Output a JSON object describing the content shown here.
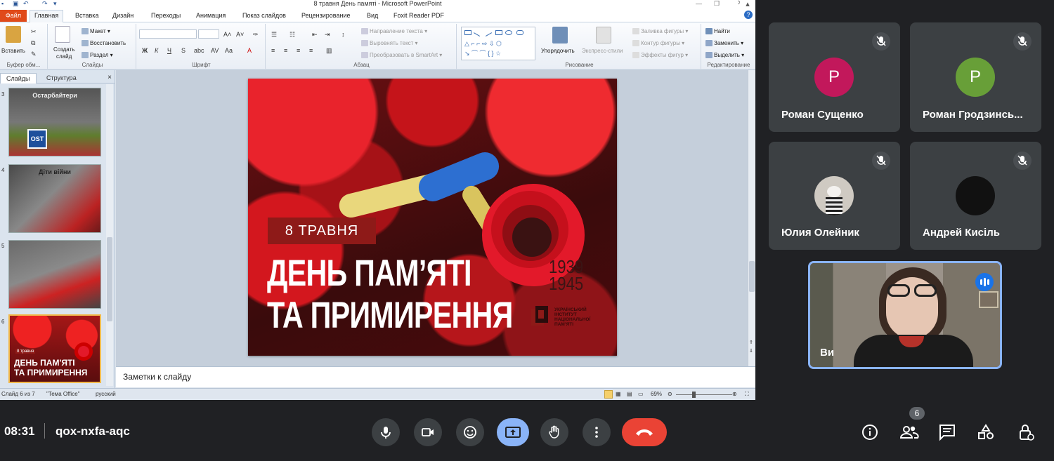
{
  "ppt": {
    "window_title": "8 травня День памяті - Microsoft PowerPoint",
    "tabs": [
      "Файл",
      "Главная",
      "Вставка",
      "Дизайн",
      "Переходы",
      "Анимация",
      "Показ слайдов",
      "Рецензирование",
      "Вид",
      "Foxit Reader PDF"
    ],
    "ribbon": {
      "clipboard": {
        "paste": "Вставить",
        "label": "Буфер обм..."
      },
      "slides": {
        "new_slide_l1": "Создать",
        "new_slide_l2": "слайд",
        "layout": "Макет",
        "reset": "Восстановить",
        "section": "Раздел",
        "label": "Слайды"
      },
      "font": {
        "label": "Шрифт",
        "bold": "Ж",
        "italic": "К",
        "underline": "Ч",
        "strike": "S",
        "shadow": "abc",
        "spacing": "AV",
        "case": "Aa",
        "color": "A"
      },
      "paragraph": {
        "text_direction": "Направление текста",
        "align_text": "Выровнять текст",
        "smartart": "Преобразовать в SmartArt",
        "label": "Абзац"
      },
      "drawing": {
        "arrange": "Упорядочить",
        "quick_styles": "Экспресс-стили",
        "shape_fill": "Заливка фигуры",
        "shape_outline": "Контур фигуры",
        "shape_effects": "Эффекты фигур",
        "label": "Рисование"
      },
      "editing": {
        "find": "Найти",
        "replace": "Заменить",
        "select": "Выделить",
        "label": "Редактирование"
      }
    },
    "pane": {
      "tab_slides": "Слайды",
      "tab_outline": "Структура",
      "close": "×",
      "thumbs": [
        {
          "num": "3",
          "title": "Остарбайтери",
          "badge": "OST"
        },
        {
          "num": "4",
          "title": "Діти війни"
        },
        {
          "num": "5",
          "title": ""
        },
        {
          "num": "6",
          "date": "8 травня",
          "line1": "ДЕНЬ ПАМ'ЯТІ",
          "line2": "ТА ПРИМИРЕННЯ"
        }
      ]
    },
    "slide": {
      "date_badge": "8 ТРАВНЯ",
      "title_line1": "ДЕНЬ ПАМ’ЯТІ",
      "title_line2": "ТА ПРИМИРЕННЯ",
      "year_start": "1939",
      "year_end": "1945",
      "institute_l1": "УКРАЇНСЬКИЙ",
      "institute_l2": "ІНСТИТУТ",
      "institute_l3": "НАЦІОНАЛЬНОЇ",
      "institute_l4": "ПАМ’ЯТІ"
    },
    "notes_placeholder": "Заметки к слайду",
    "status": {
      "slide_of": "Слайд 6 из 7",
      "theme": "\"Тема Office\"",
      "language": "русский",
      "zoom": "69%"
    }
  },
  "meet": {
    "participants": [
      {
        "initial": "Р",
        "name": "Роман Сущенко",
        "color": "#c2185b",
        "muted": true
      },
      {
        "initial": "Р",
        "name": "Роман Гродзинсь...",
        "color": "#689f38",
        "muted": true
      },
      {
        "initial": "",
        "name": "Юлия Олейник",
        "color": "#cfcac2",
        "muted": true
      },
      {
        "initial": "",
        "name": "Андрей Кисіль",
        "color": "#111111",
        "muted": true
      }
    ],
    "self_name": "Ви",
    "time": "08:31",
    "meeting_code": "qox-nxfa-aqc",
    "people_count": "6",
    "colors": {
      "accent": "#8ab4f8",
      "end_call": "#ea4335",
      "present": "#8ab4f8",
      "tile": "#3c4043"
    }
  }
}
